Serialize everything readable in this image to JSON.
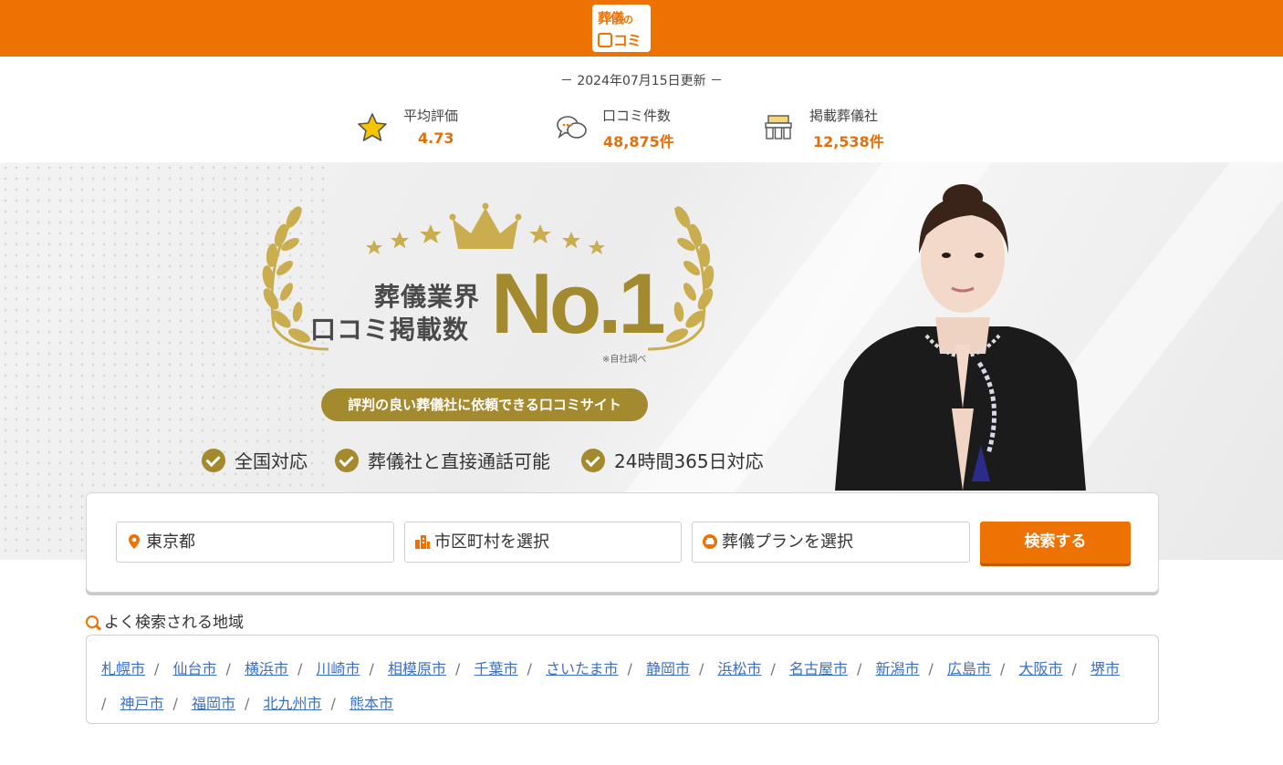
{
  "header": {
    "logo_line1": "葬儀",
    "logo_line1_small": "の",
    "logo_line2": "コミ",
    "brand_color": "#ee7202"
  },
  "updated": "－ 2024年07月15日更新 －",
  "stats": [
    {
      "label": "平均評価",
      "value": "4.73",
      "icon": "star-icon"
    },
    {
      "label": "口コミ件数",
      "value": "48,875件",
      "icon": "chat-bubbles-icon"
    },
    {
      "label": "掲載葬儀社",
      "value": "12,538件",
      "icon": "funeral-hall-icon"
    }
  ],
  "hero": {
    "headline_line1": "葬儀業界",
    "headline_line2": "口コミ掲載数",
    "badge": "No.1",
    "note": "※自社調べ",
    "tagline": "評判の良い葬儀社に依頼できる口コミサイト",
    "features": [
      "全国対応",
      "葬儀社と直接通話可能",
      "24時間365日対応"
    ],
    "gold_color": "#a48a2e"
  },
  "search": {
    "prefecture": "東京都",
    "city_placeholder": "市区町村を選択",
    "plan_placeholder": "葬儀プランを選択",
    "button_label": "検索する"
  },
  "popular": {
    "title": "よく検索される地域",
    "areas": [
      "札幌市",
      "仙台市",
      "横浜市",
      "川崎市",
      "相模原市",
      "千葉市",
      "さいたま市",
      "静岡市",
      "浜松市",
      "名古屋市",
      "新潟市",
      "広島市",
      "大阪市",
      "堺市",
      "神戸市",
      "福岡市",
      "北九州市",
      "熊本市"
    ],
    "separator": "/"
  }
}
